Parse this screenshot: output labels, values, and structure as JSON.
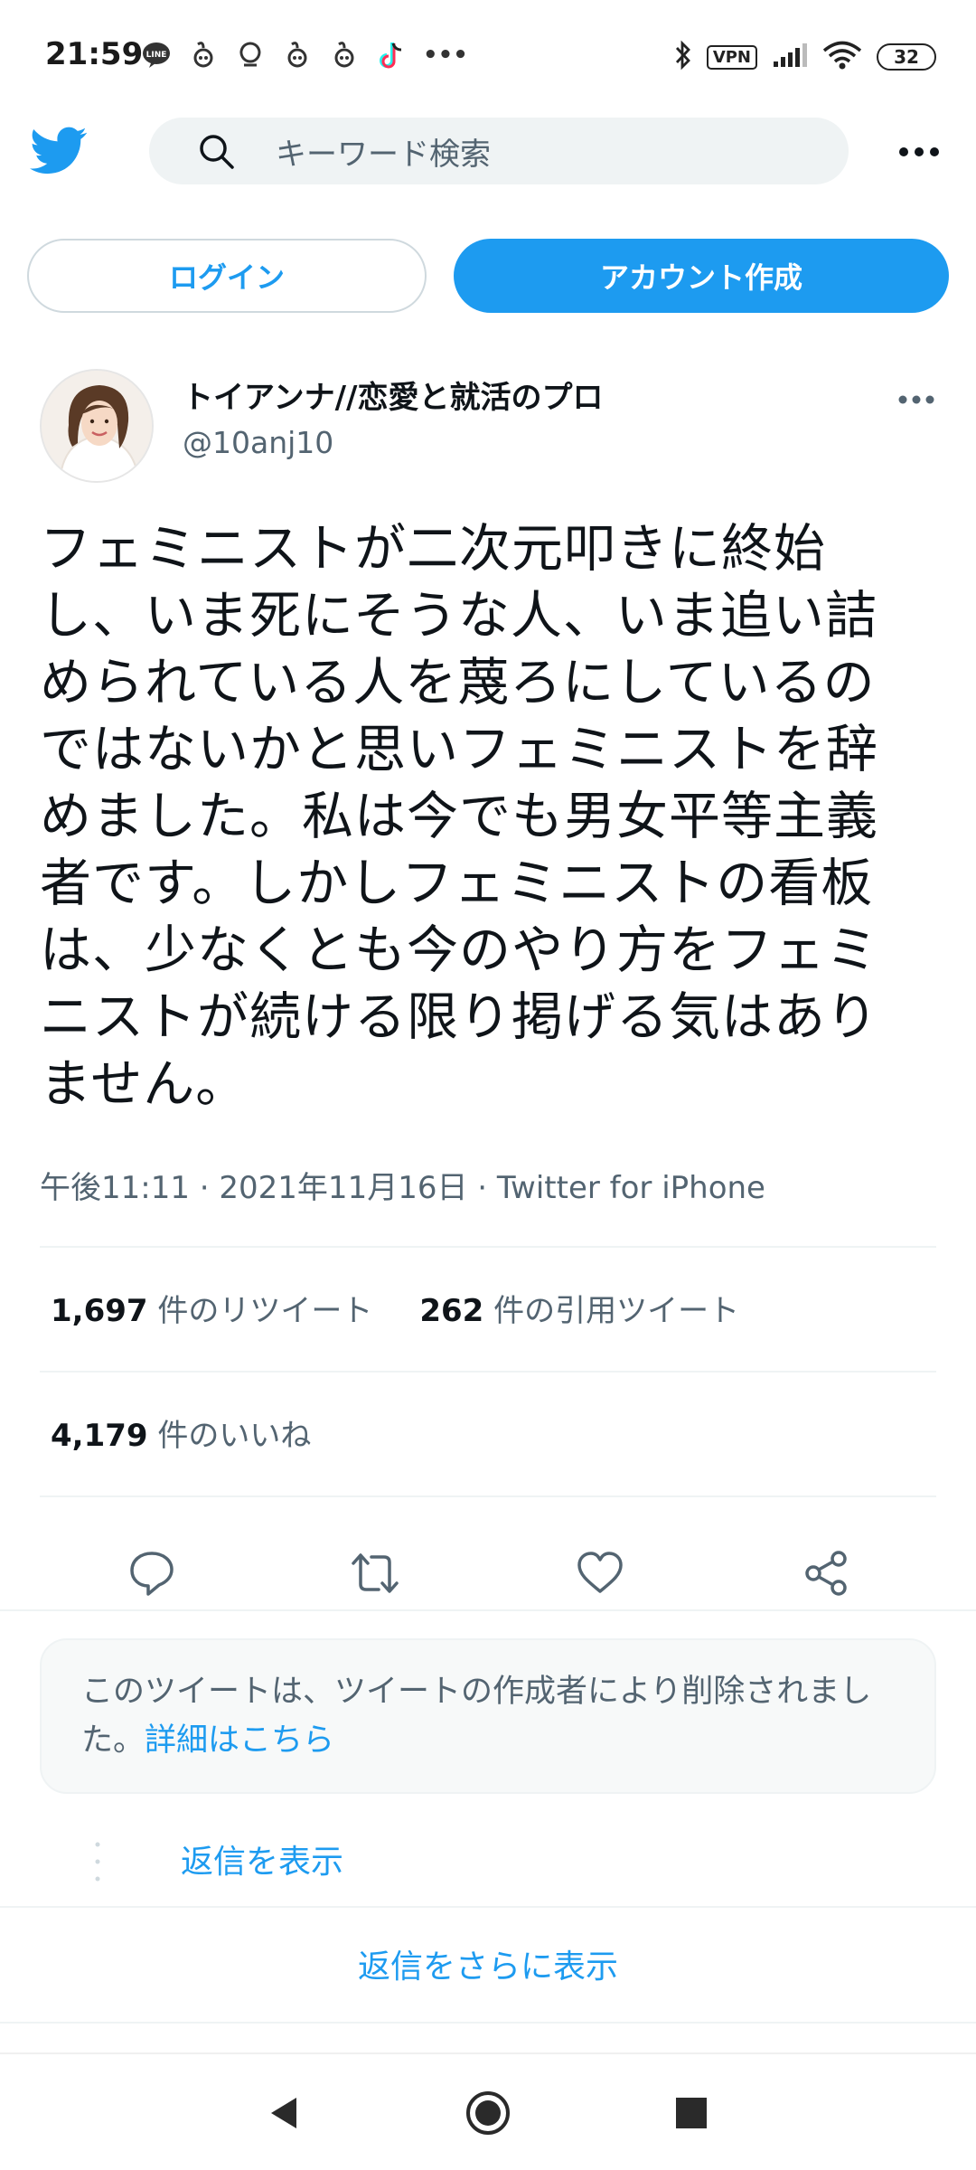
{
  "status_bar": {
    "time": "21:59",
    "notification_icons": [
      "line-icon",
      "notification-icon",
      "notification-icon",
      "notification-icon",
      "notification-icon",
      "tiktok-icon"
    ],
    "more": "•••",
    "vpn": "VPN",
    "battery": "32"
  },
  "header": {
    "search_placeholder": "キーワード検索"
  },
  "auth": {
    "login_label": "ログイン",
    "signup_label": "アカウント作成"
  },
  "tweet": {
    "author_name": "トイアンナ//恋愛と就活のプロ",
    "handle": "@10anj10",
    "lines": [
      "フェミニストが二次元叩きに終始",
      "し、いま死にそうな人、いま追い詰",
      "められている人を蔑ろにしているの",
      "ではないかと思いフェミニストを辞",
      "めました。私は今でも男女平等主義",
      "者です。しかしフェミニストの看板",
      "は、少なくとも今のやり方をフェミ",
      "ニストが続ける限り掲げる気はあり",
      "ません。"
    ],
    "meta": "午後11:11 · 2021年11月16日 · Twitter for iPhone",
    "retweets_count": "1,697",
    "retweets_label": " 件のリツイート",
    "quotes_count": "262",
    "quotes_label": " 件の引用ツイート",
    "likes_count": "4,179",
    "likes_label": " 件のいいね"
  },
  "deleted_notice": {
    "text": "このツイートは、ツイートの作成者により削除されました。",
    "link": "詳細はこちら"
  },
  "replies": {
    "show_reply": "返信を表示",
    "show_more": "返信をさらに表示"
  },
  "colors": {
    "accent": "#1d9bf0",
    "text": "#0f1419",
    "secondary": "#536471"
  }
}
